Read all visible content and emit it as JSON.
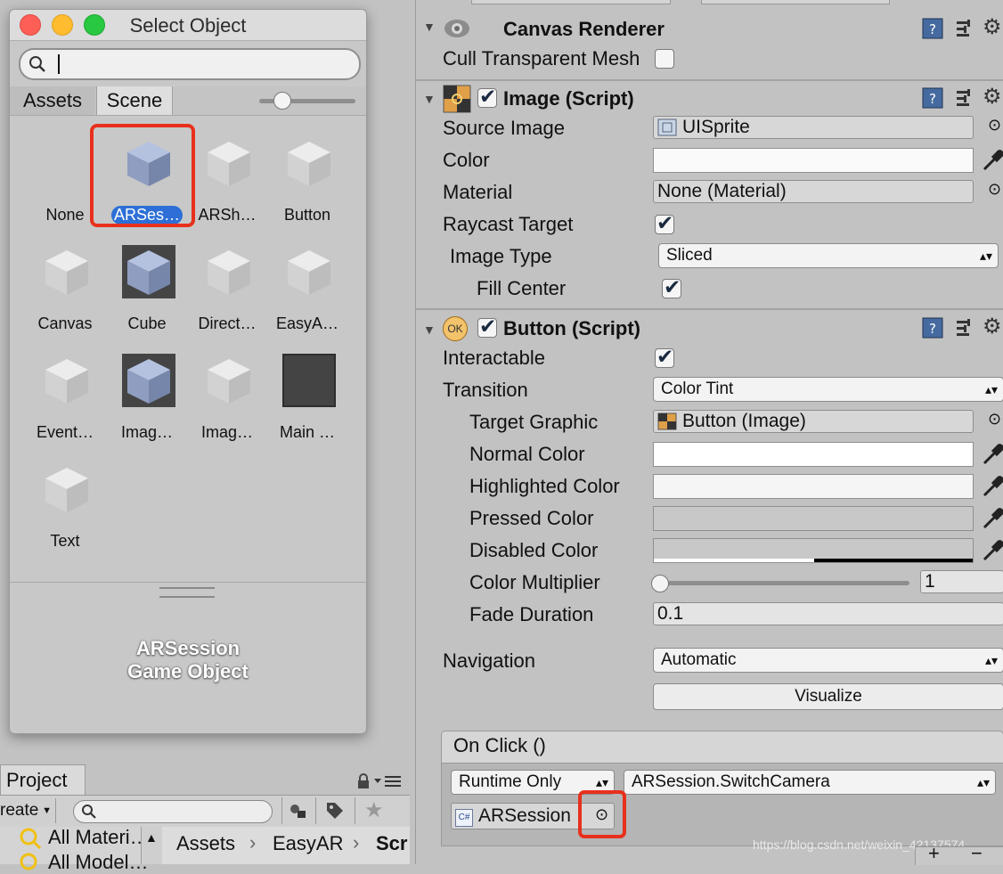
{
  "select_window": {
    "title": "Select Object",
    "search": {
      "value": "",
      "placeholder": ""
    },
    "tabs": [
      "Assets",
      "Scene"
    ],
    "active_tab": "Scene",
    "objects": [
      {
        "label": "None",
        "thumb": "none"
      },
      {
        "label": "ARSes…",
        "thumb": "cube-blue",
        "selected": true
      },
      {
        "label": "ARSh…",
        "thumb": "cube"
      },
      {
        "label": "Button",
        "thumb": "cube"
      },
      {
        "label": "Canvas",
        "thumb": "cube"
      },
      {
        "label": "Cube",
        "thumb": "cube-blue-dark"
      },
      {
        "label": "Direct…",
        "thumb": "cube"
      },
      {
        "label": "EasyA…",
        "thumb": "cube"
      },
      {
        "label": "Event…",
        "thumb": "cube"
      },
      {
        "label": "Imag…",
        "thumb": "cube-blue-dark"
      },
      {
        "label": "Imag…",
        "thumb": "cube"
      },
      {
        "label": "Main …",
        "thumb": "dark-square"
      },
      {
        "label": "Text",
        "thumb": "cube"
      }
    ],
    "preview": {
      "name": "ARSession",
      "type": "Game Object"
    }
  },
  "project": {
    "tab": "Project",
    "create_label": "reate",
    "tree": [
      "All Materi…",
      "All Model…"
    ],
    "breadcrumb": [
      "Assets",
      "EasyAR",
      "Scr"
    ]
  },
  "inspector": {
    "canvas_renderer": {
      "title": "Canvas Renderer",
      "cull_label": "Cull Transparent Mesh"
    },
    "image": {
      "title": "Image (Script)",
      "source_image_label": "Source Image",
      "source_image_value": "UISprite",
      "color_label": "Color",
      "material_label": "Material",
      "material_value": "None (Material)",
      "raycast_label": "Raycast Target",
      "image_type_label": "Image Type",
      "image_type_value": "Sliced",
      "fill_center_label": "Fill Center"
    },
    "button": {
      "title": "Button (Script)",
      "interactable_label": "Interactable",
      "transition_label": "Transition",
      "transition_value": "Color Tint",
      "target_graphic_label": "Target Graphic",
      "target_graphic_value": "Button (Image)",
      "normal_color_label": "Normal Color",
      "highlighted_color_label": "Highlighted Color",
      "pressed_color_label": "Pressed Color",
      "disabled_color_label": "Disabled Color",
      "color_multiplier_label": "Color Multiplier",
      "color_multiplier_value": "1",
      "fade_duration_label": "Fade Duration",
      "fade_duration_value": "0.1",
      "navigation_label": "Navigation",
      "navigation_value": "Automatic",
      "visualize_label": "Visualize",
      "on_click_label": "On Click ()",
      "runtime_value": "Runtime Only",
      "function_value": "ARSession.SwitchCamera",
      "object_value": "ARSession",
      "script_icon_text": "C#"
    }
  },
  "watermark": "https://blog.csdn.net/weixin_42137574",
  "colors": {
    "highlight_red": "#e8301c",
    "selection_blue": "#2d6fd6"
  }
}
